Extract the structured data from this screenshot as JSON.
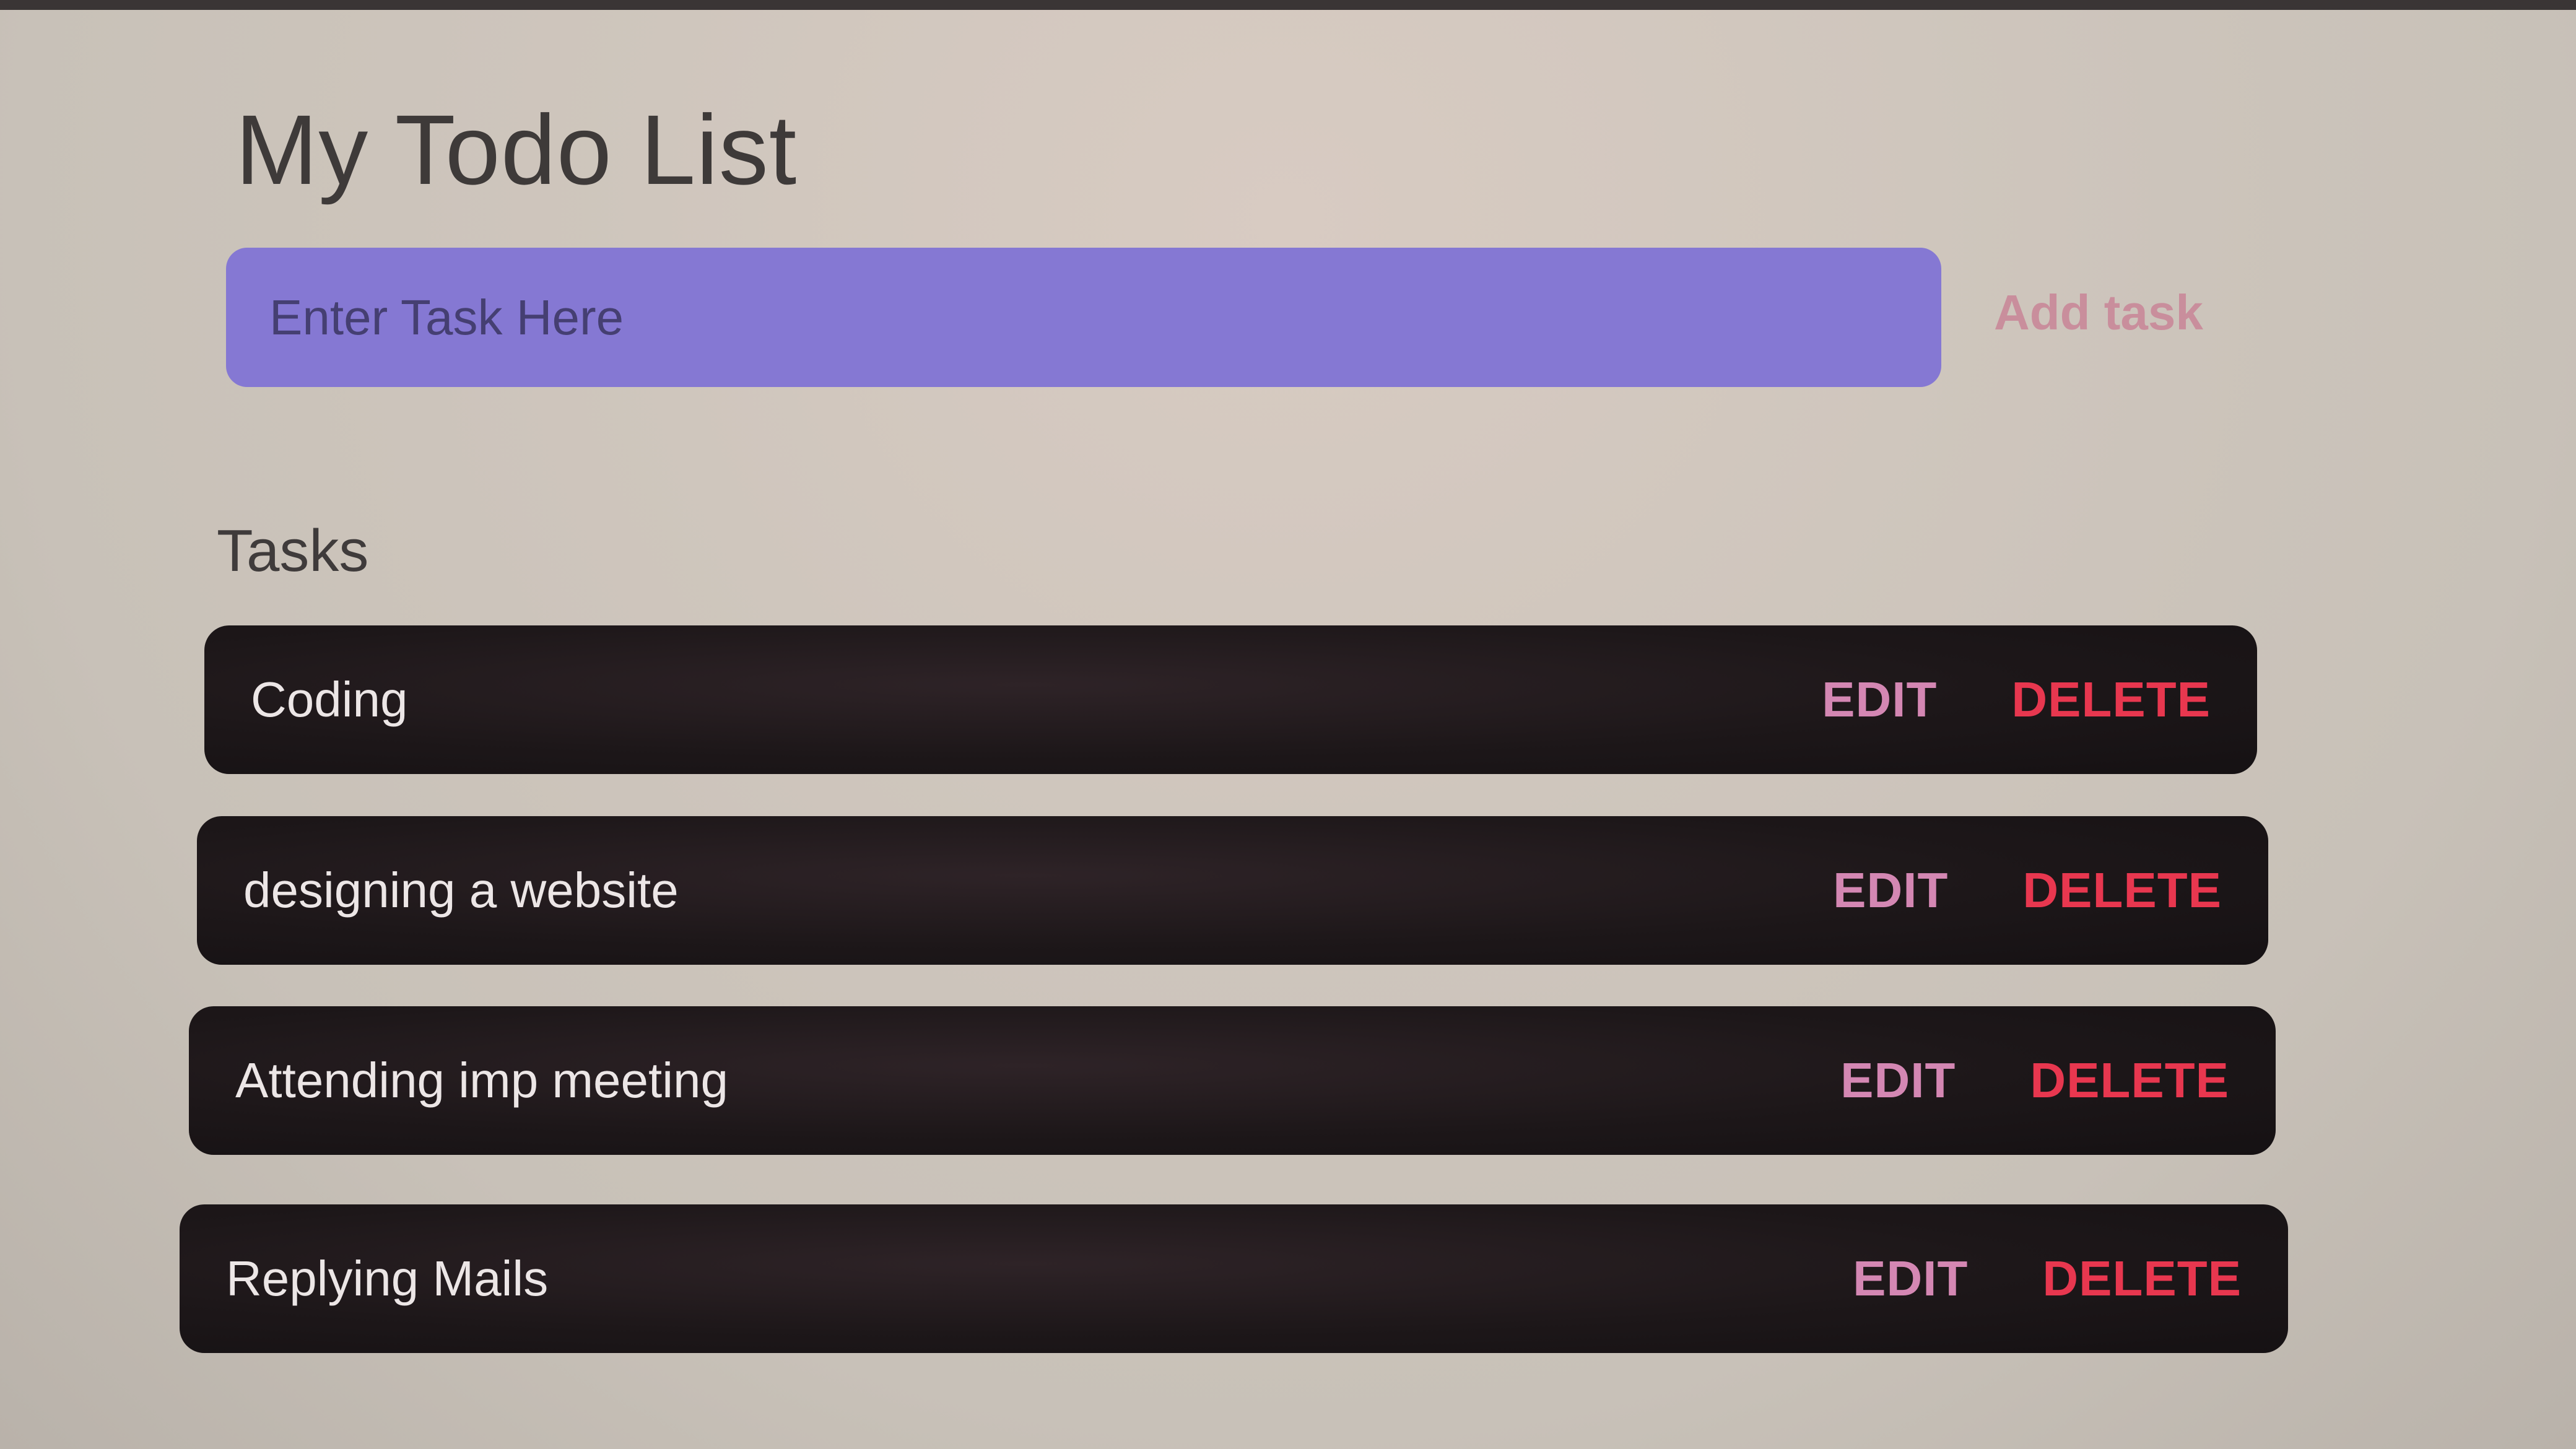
{
  "app": {
    "title": "My Todo List"
  },
  "form": {
    "input_placeholder": "Enter Task Here",
    "input_value": "",
    "add_label": "Add task"
  },
  "tasks_section": {
    "heading": "Tasks",
    "edit_label": "EDIT",
    "delete_label": "DELETE",
    "items": [
      {
        "text": "Coding"
      },
      {
        "text": "designing a website"
      },
      {
        "text": "Attending imp meeting"
      },
      {
        "text": "Replying Mails"
      }
    ]
  },
  "colors": {
    "input_bg": "#8578d3",
    "add_label": "#c98e9c",
    "row_bg": "#1d1719",
    "edit": "#d487b3",
    "delete": "#e8374f",
    "page_bg": "#cfc6bd"
  }
}
